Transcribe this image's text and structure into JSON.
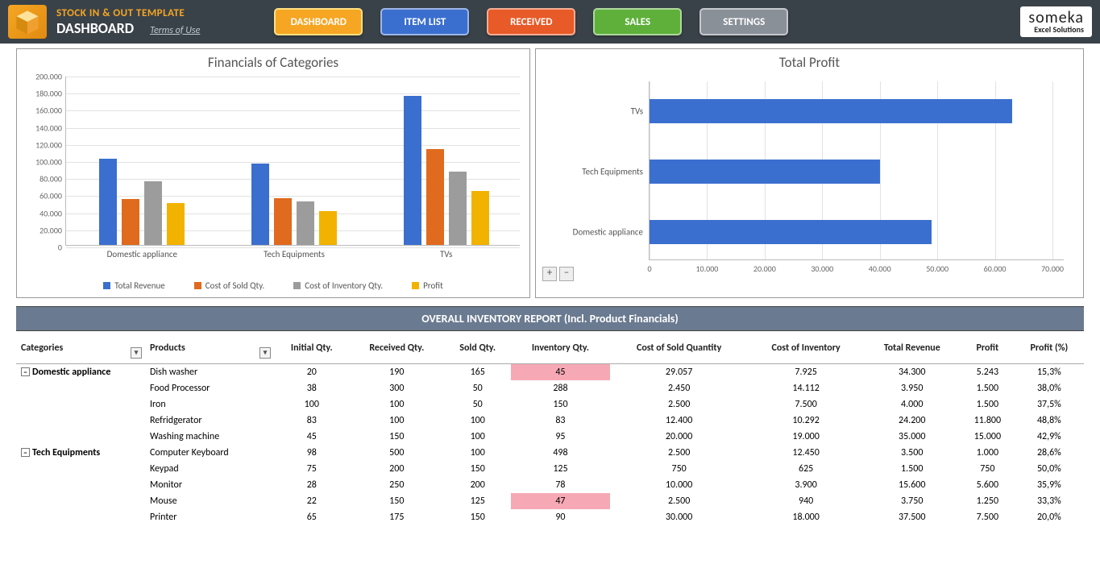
{
  "header": {
    "title_small": "STOCK IN & OUT TEMPLATE",
    "title_big": "DASHBOARD",
    "terms": "Terms of Use",
    "nav": {
      "dashboard": "DASHBOARD",
      "itemlist": "ITEM LIST",
      "received": "RECEIVED",
      "sales": "SALES",
      "settings": "SETTINGS"
    },
    "brand_big": "someka",
    "brand_small": "Excel Solutions"
  },
  "report_band": "OVERALL INVENTORY REPORT (Incl. Product Financials)",
  "zoom": {
    "plus": "+",
    "minus": "–"
  },
  "table": {
    "headers": {
      "categories": "Categories",
      "products": "Products",
      "initial": "Initial Qty.",
      "received": "Received Qty.",
      "sold": "Sold Qty.",
      "inventory": "Inventory Qty.",
      "cost_sold": "Cost of Sold Quantity",
      "cost_inv": "Cost of Inventory",
      "revenue": "Total Revenue",
      "profit": "Profit",
      "profit_pct": "Profit (%)"
    },
    "groups": [
      {
        "name": "Domestic appliance",
        "rows": [
          {
            "product": "Dish washer",
            "initial": "20",
            "received": "190",
            "sold": "165",
            "inventory": "45",
            "inv_hl": true,
            "cost_sold": "29.057",
            "cost_inv": "7.925",
            "revenue": "34.300",
            "profit": "5.243",
            "pct": "15,3%"
          },
          {
            "product": "Food Processor",
            "initial": "38",
            "received": "300",
            "sold": "50",
            "inventory": "288",
            "cost_sold": "2.450",
            "cost_inv": "14.112",
            "revenue": "3.950",
            "profit": "1.500",
            "pct": "38,0%"
          },
          {
            "product": "Iron",
            "initial": "100",
            "received": "100",
            "sold": "50",
            "inventory": "150",
            "cost_sold": "2.500",
            "cost_inv": "7.500",
            "revenue": "4.000",
            "profit": "1.500",
            "pct": "37,5%"
          },
          {
            "product": "Refridgerator",
            "initial": "83",
            "received": "100",
            "sold": "100",
            "inventory": "83",
            "cost_sold": "12.400",
            "cost_inv": "10.292",
            "revenue": "24.200",
            "profit": "11.800",
            "pct": "48,8%"
          },
          {
            "product": "Washing machine",
            "initial": "45",
            "received": "150",
            "sold": "100",
            "inventory": "95",
            "cost_sold": "20.000",
            "cost_inv": "19.000",
            "revenue": "35.000",
            "profit": "15.000",
            "pct": "42,9%"
          }
        ]
      },
      {
        "name": "Tech Equipments",
        "rows": [
          {
            "product": "Computer Keyboard",
            "initial": "98",
            "received": "500",
            "sold": "100",
            "inventory": "498",
            "cost_sold": "2.500",
            "cost_inv": "12.450",
            "revenue": "3.500",
            "profit": "1.000",
            "pct": "28,6%"
          },
          {
            "product": "Keypad",
            "initial": "75",
            "received": "200",
            "sold": "150",
            "inventory": "125",
            "cost_sold": "750",
            "cost_inv": "625",
            "revenue": "1.500",
            "profit": "750",
            "pct": "50,0%"
          },
          {
            "product": "Monitor",
            "initial": "28",
            "received": "250",
            "sold": "200",
            "inventory": "78",
            "cost_sold": "10.000",
            "cost_inv": "3.900",
            "revenue": "15.600",
            "profit": "5.600",
            "pct": "35,9%"
          },
          {
            "product": "Mouse",
            "initial": "22",
            "received": "150",
            "sold": "125",
            "inventory": "47",
            "inv_hl": true,
            "cost_sold": "2.500",
            "cost_inv": "940",
            "revenue": "3.750",
            "profit": "1.250",
            "pct": "33,3%"
          },
          {
            "product": "Printer",
            "initial": "65",
            "received": "175",
            "sold": "150",
            "inventory": "90",
            "cost_sold": "30.000",
            "cost_inv": "18.000",
            "revenue": "37.500",
            "profit": "7.500",
            "pct": "20,0%"
          }
        ]
      }
    ]
  },
  "chart_data": [
    {
      "type": "bar",
      "title": "Financials of Categories",
      "categories": [
        "Domestic appliance",
        "Tech Equipments",
        "TVs"
      ],
      "series": [
        {
          "name": "Total Revenue",
          "values": [
            101000,
            95000,
            175000
          ],
          "color": "#3b6fcf"
        },
        {
          "name": "Cost of Sold Qty.",
          "values": [
            54000,
            55000,
            112000
          ],
          "color": "#e06a1e"
        },
        {
          "name": "Cost of Inventory Qty.",
          "values": [
            75000,
            51000,
            86000
          ],
          "color": "#9c9c9c"
        },
        {
          "name": "Profit",
          "values": [
            49000,
            40000,
            63000
          ],
          "color": "#f2b200"
        }
      ],
      "ylim": [
        0,
        200000
      ],
      "yticks": [
        "0",
        "20.000",
        "40.000",
        "60.000",
        "80.000",
        "100.000",
        "120.000",
        "140.000",
        "160.000",
        "180.000",
        "200.000"
      ]
    },
    {
      "type": "bar-horizontal",
      "title": "Total Profit",
      "categories": [
        "TVs",
        "Tech Equipments",
        "Domestic appliance"
      ],
      "values": [
        63000,
        40000,
        49000
      ],
      "xlim": [
        0,
        70000
      ],
      "xticks": [
        "0",
        "10.000",
        "20.000",
        "30.000",
        "40.000",
        "50.000",
        "60.000",
        "70.000"
      ],
      "color": "#3b6fcf"
    }
  ]
}
